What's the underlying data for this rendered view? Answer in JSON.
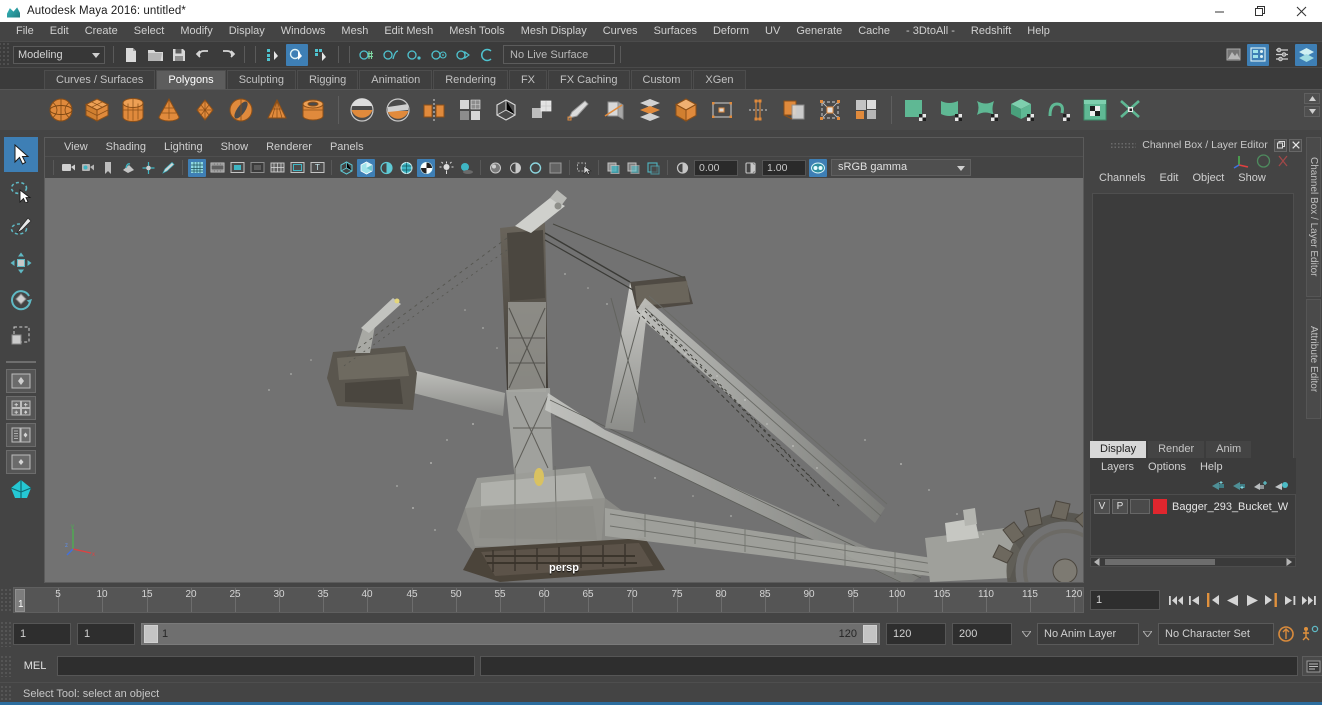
{
  "window": {
    "title": "Autodesk Maya 2016: untitled*",
    "logo_icon": "maya-logo-icon",
    "controls": [
      {
        "name": "minimize",
        "icon": "minimize-icon"
      },
      {
        "name": "restore",
        "icon": "restore-icon"
      },
      {
        "name": "close",
        "icon": "close-icon"
      }
    ]
  },
  "menubar": {
    "items": [
      "File",
      "Edit",
      "Create",
      "Select",
      "Modify",
      "Display",
      "Windows",
      "Mesh",
      "Edit Mesh",
      "Mesh Tools",
      "Mesh Display",
      "Curves",
      "Surfaces",
      "Deform",
      "UV",
      "Generate",
      "Cache",
      "- 3DtoAll -",
      "Redshift",
      "Help"
    ]
  },
  "statusline": {
    "menu_set": "Modeling",
    "live_surface": "No Live Surface",
    "file_icons": [
      "new-scene-icon",
      "open-scene-icon",
      "save-scene-icon",
      "undo-icon",
      "redo-icon"
    ],
    "select_mode_icons": [
      "select-by-hierarchy-icon",
      "select-by-object-type-icon",
      "select-by-component-type-icon"
    ],
    "snap_icons": [
      "snap-to-grid-icon",
      "snap-to-curve-icon",
      "snap-to-point-icon",
      "snap-to-projected-center-icon",
      "snap-to-view-plane-icon",
      "make-live-icon"
    ],
    "right_icons": [
      "render-view-icon",
      "attribute-editor-icon",
      "tool-settings-icon",
      "channel-box-icon"
    ]
  },
  "shelf": {
    "tabs": [
      {
        "label": "Curves / Surfaces",
        "active": false
      },
      {
        "label": "Polygons",
        "active": true
      },
      {
        "label": "Sculpting",
        "active": false
      },
      {
        "label": "Rigging",
        "active": false
      },
      {
        "label": "Animation",
        "active": false
      },
      {
        "label": "Rendering",
        "active": false
      },
      {
        "label": "FX",
        "active": false
      },
      {
        "label": "FX Caching",
        "active": false
      },
      {
        "label": "Custom",
        "active": false
      },
      {
        "label": "XGen",
        "active": false
      }
    ],
    "icons": [
      {
        "name": "poly-sphere-icon",
        "color": "#e08a3c",
        "shape": "sphere"
      },
      {
        "name": "poly-cube-icon",
        "color": "#e08a3c",
        "shape": "cube"
      },
      {
        "name": "poly-cylinder-icon",
        "color": "#e08a3c",
        "shape": "cylinder"
      },
      {
        "name": "poly-cone-icon",
        "color": "#e08a3c",
        "shape": "cone"
      },
      {
        "name": "poly-plane-icon",
        "color": "#e08a3c",
        "shape": "plane"
      },
      {
        "name": "poly-torus-icon",
        "color": "#e08a3c",
        "shape": "torus"
      },
      {
        "name": "poly-prism-icon",
        "color": "#e08a3c",
        "shape": "prism"
      },
      {
        "name": "poly-pipe-icon",
        "color": "#e08a3c",
        "shape": "pipe"
      },
      {
        "name": "sep-1",
        "shape": "sep"
      },
      {
        "name": "boolean-union-icon",
        "color": "#cfcfcf",
        "shape": "boolean"
      },
      {
        "name": "boolean-difference-icon",
        "color": "#cfcfcf",
        "shape": "boolean2"
      },
      {
        "name": "mirror-geometry-icon",
        "color": "#e08a3c",
        "shape": "mirror"
      },
      {
        "name": "combine-icon",
        "color": "#cfcfcf",
        "shape": "grid4"
      },
      {
        "name": "smooth-icon",
        "color": "#cfcfcf",
        "shape": "cube-wire"
      },
      {
        "name": "extract-icon",
        "color": "#cfcfcf",
        "shape": "grid-extract"
      },
      {
        "name": "poly-create-tool-icon",
        "color": "#cfcfcf",
        "shape": "pen"
      },
      {
        "name": "multi-cut-icon",
        "color": "#cfcfcf",
        "shape": "cut"
      },
      {
        "name": "reduce-icon",
        "color": "#e08a3c",
        "shape": "layers"
      },
      {
        "name": "bevel-icon",
        "color": "#e08a3c",
        "shape": "bevel-cube"
      },
      {
        "name": "offset-edge-icon",
        "color": "#cfcfcf",
        "shape": "offset"
      },
      {
        "name": "bridge-icon",
        "color": "#e08a3c",
        "shape": "bridge"
      },
      {
        "name": "extrude-icon",
        "color": "#e08a3c",
        "shape": "extrude"
      },
      {
        "name": "wedge-icon",
        "color": "#cfcfcf",
        "shape": "wedge"
      },
      {
        "name": "append-polygon-icon",
        "color": "#e08a3c",
        "shape": "append"
      },
      {
        "name": "sep-2",
        "shape": "sep"
      },
      {
        "name": "planar-uv-icon",
        "color": "#5fb894",
        "shape": "uv-planar"
      },
      {
        "name": "cylindrical-uv-icon",
        "color": "#5fb894",
        "shape": "uv-cyl"
      },
      {
        "name": "spherical-uv-icon",
        "color": "#5fb894",
        "shape": "uv-sph"
      },
      {
        "name": "automatic-uv-icon",
        "color": "#5fb894",
        "shape": "uv-auto"
      },
      {
        "name": "uv-unfold-icon",
        "color": "#5fb894",
        "shape": "uv-unfold"
      },
      {
        "name": "uv-editor-icon",
        "color": "#5fb894",
        "shape": "uv-editor"
      },
      {
        "name": "uv-layout-icon",
        "color": "#5fb894",
        "shape": "uv-layout"
      }
    ]
  },
  "toolbox": {
    "tools": [
      {
        "name": "select-tool",
        "icon": "arrow-cursor-icon",
        "active": true
      },
      {
        "name": "lasso-select-tool",
        "icon": "lasso-icon",
        "active": false
      },
      {
        "name": "paint-select-tool",
        "icon": "paint-brush-icon",
        "active": false
      },
      {
        "name": "move-tool",
        "icon": "move-arrows-icon",
        "active": false
      },
      {
        "name": "rotate-tool",
        "icon": "rotate-circle-icon",
        "active": false
      },
      {
        "name": "scale-tool",
        "icon": "scale-box-icon",
        "active": false
      }
    ],
    "layouts": [
      {
        "name": "layout-single-pane",
        "icon": "single-pane-icon"
      },
      {
        "name": "layout-four-pane",
        "icon": "four-pane-icon"
      },
      {
        "name": "layout-persp-outliner",
        "icon": "persp-outliner-icon"
      },
      {
        "name": "layout-persp-graph",
        "icon": "persp-graph-icon"
      },
      {
        "name": "layout-hypershade",
        "icon": "hypershade-icon"
      }
    ]
  },
  "viewport": {
    "menus": [
      "View",
      "Shading",
      "Lighting",
      "Show",
      "Renderer",
      "Panels"
    ],
    "camera_label": "persp",
    "exposure": "0.00",
    "gamma": "1.00",
    "color_space": "sRGB gamma",
    "toolbar_icons": [
      "select-camera-icon",
      "camera-attributes-icon",
      "bookmark-icon",
      "image-plane-icon",
      "two-d-pan-zoom-icon",
      "grease-pencil-icon",
      "grid-toggle-icon",
      "film-gate-icon",
      "resolution-gate-icon",
      "gate-mask-icon",
      "field-chart-icon",
      "safe-action-icon",
      "safe-title-icon",
      "wireframe-icon",
      "smooth-shade-all-icon",
      "shade-textured-icon",
      "shade-wireframe-icon",
      "texture-toggle-icon",
      "use-all-lights-icon",
      "shadows-icon",
      "screen-space-ao-icon",
      "motion-blur-icon",
      "multisample-icon",
      "depth-of-field-icon",
      "isolate-select-icon",
      "xray-icon",
      "xray-joints-icon",
      "xray-active-components-icon",
      "exposure-icon",
      "gamma-icon",
      "color-management-icon"
    ],
    "axis_gizmo": {
      "x": "x",
      "y": "y",
      "z": "z"
    }
  },
  "channel_box": {
    "panel_title": "Channel Box / Layer Editor",
    "menus": [
      "Channels",
      "Edit",
      "Object",
      "Show"
    ],
    "manip_icons": [
      "manipulator-icon",
      "sphere-display-icon",
      "red-display-icon"
    ],
    "window_buttons": [
      "undock-icon",
      "close-icon"
    ],
    "side_tabs": [
      "Channel Box / Layer Editor",
      "Attribute Editor"
    ]
  },
  "layer_editor": {
    "tabs": [
      {
        "label": "Display",
        "active": true
      },
      {
        "label": "Render",
        "active": false
      },
      {
        "label": "Anim",
        "active": false
      }
    ],
    "menus": [
      "Layers",
      "Options",
      "Help"
    ],
    "toolbar_icons": [
      "new-layer-icon",
      "new-layer-from-selected-icon",
      "add-selected-to-layer-icon",
      "select-objects-in-layer-icon"
    ],
    "layers": [
      {
        "visibility": "V",
        "playback": "P",
        "shading": "",
        "color": "#e0262e",
        "name": "Bagger_293_Bucket_W"
      }
    ]
  },
  "time_slider": {
    "current_frame_marker": "1",
    "current_frame_field": "1",
    "tick_start": 5,
    "tick_end": 120,
    "tick_step": 5,
    "ticks": [
      5,
      10,
      15,
      20,
      25,
      30,
      35,
      40,
      45,
      50,
      55,
      60,
      65,
      70,
      75,
      80,
      85,
      90,
      95,
      100,
      105,
      110,
      115,
      120
    ],
    "transport_buttons": [
      "go-to-start-icon",
      "step-back-frame-icon",
      "step-back-key-icon",
      "play-backwards-icon",
      "play-forwards-icon",
      "step-forward-key-icon",
      "step-forward-frame-icon",
      "go-to-end-icon"
    ]
  },
  "range_slider": {
    "anim_start": "1",
    "range_start": "1",
    "slider_min_label": "1",
    "slider_max_label": "120",
    "range_end": "120",
    "anim_end": "200",
    "anim_layer": "No Anim Layer",
    "character_set": "No Character Set",
    "right_icons": [
      "auto-keyframe-icon",
      "animation-preferences-icon"
    ]
  },
  "command_line": {
    "language_label": "MEL",
    "input_value": "",
    "script_editor_icon": "script-editor-icon"
  },
  "help_line": {
    "message": "Select Tool: select an object"
  },
  "colors": {
    "accent_blue": "#3e7fb5",
    "orange": "#e08a3c",
    "green": "#5fb894",
    "layer_red": "#e0262e",
    "panel_bg": "#444444",
    "viewport_bg": "#727272"
  }
}
